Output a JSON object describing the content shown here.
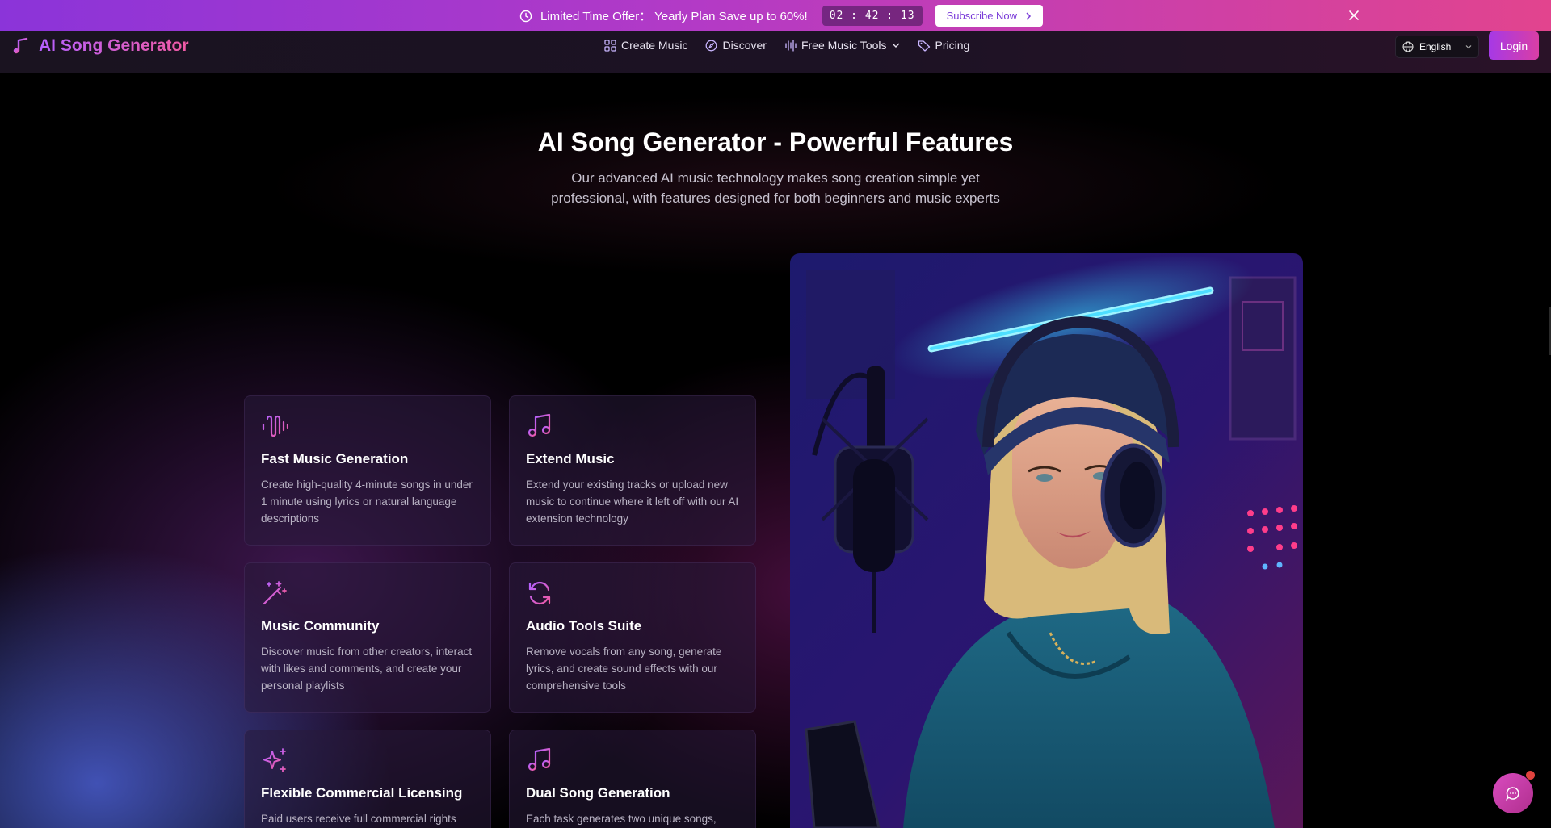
{
  "promo": {
    "text": "Limited Time Offer： Yearly Plan Save up to 60%!",
    "timer": "02 : 42 : 13",
    "cta": "Subscribe Now"
  },
  "header": {
    "brand": "AI Song Generator",
    "nav": [
      {
        "label": "Create Music",
        "icon": "grid-icon"
      },
      {
        "label": "Discover",
        "icon": "compass-icon"
      },
      {
        "label": "Free Music Tools",
        "icon": "waveform-icon"
      },
      {
        "label": "Pricing",
        "icon": "tag-icon"
      }
    ],
    "language": "English",
    "login": "Login"
  },
  "hero": {
    "title": "AI Song Generator - Powerful Features",
    "subtitle": "Our advanced AI music technology makes song creation simple yet professional, with features designed for both beginners and music experts"
  },
  "features": [
    {
      "icon": "waveform-icon",
      "title": "Fast Music Generation",
      "desc": "Create high-quality 4-minute songs in under 1 minute using lyrics or natural language descriptions"
    },
    {
      "icon": "music-note-icon",
      "title": "Extend Music",
      "desc": "Extend your existing tracks or upload new music to continue where it left off with our AI extension technology"
    },
    {
      "icon": "magic-wand-icon",
      "title": "Music Community",
      "desc": "Discover music from other creators, interact with likes and comments, and create your personal playlists"
    },
    {
      "icon": "refresh-icon",
      "title": "Audio Tools Suite",
      "desc": "Remove vocals from any song, generate lyrics, and create sound effects with our comprehensive tools"
    },
    {
      "icon": "sparkles-icon",
      "title": "Flexible Commercial Licensing",
      "desc": "Paid users receive full commercial rights"
    },
    {
      "icon": "music-note-icon",
      "title": "Dual Song Generation",
      "desc": "Each task generates two unique songs,"
    }
  ],
  "colors": {
    "accent_purple": "#a639e6",
    "accent_pink": "#e2448e",
    "icon_gradient_start": "#b561ff",
    "icon_gradient_end": "#f05aa3"
  }
}
